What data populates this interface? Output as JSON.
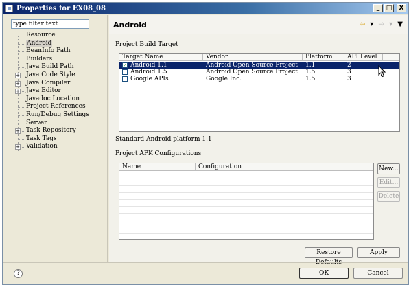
{
  "window": {
    "title": "Properties for EX08_08",
    "minimize": "_",
    "maximize": "□",
    "close": "X"
  },
  "sidebar": {
    "filter_value": "type filter text",
    "items": [
      {
        "label": "Resource",
        "expandable": false
      },
      {
        "label": "Android",
        "expandable": false,
        "selected": true
      },
      {
        "label": "BeanInfo Path",
        "expandable": false
      },
      {
        "label": "Builders",
        "expandable": false
      },
      {
        "label": "Java Build Path",
        "expandable": false
      },
      {
        "label": "Java Code Style",
        "expandable": true
      },
      {
        "label": "Java Compiler",
        "expandable": true
      },
      {
        "label": "Java Editor",
        "expandable": true
      },
      {
        "label": "Javadoc Location",
        "expandable": false
      },
      {
        "label": "Project References",
        "expandable": false
      },
      {
        "label": "Run/Debug Settings",
        "expandable": false
      },
      {
        "label": "Server",
        "expandable": false
      },
      {
        "label": "Task Repository",
        "expandable": true
      },
      {
        "label": "Task Tags",
        "expandable": false
      },
      {
        "label": "Validation",
        "expandable": true
      }
    ],
    "expand_glyph": "+"
  },
  "page": {
    "title": "Android",
    "nav_icons": {
      "back": "⇦",
      "back_menu": "▾",
      "forward": "⇨",
      "forward_menu": "▾",
      "view_menu": "▼"
    }
  },
  "build_target": {
    "section_label": "Project Build Target",
    "columns": [
      "Target Name",
      "Vendor",
      "Platform",
      "API Level"
    ],
    "rows": [
      {
        "checked": true,
        "name": "Android 1.1",
        "vendor": "Android Open Source Project",
        "platform": "1.1",
        "api": "2",
        "selected": true
      },
      {
        "checked": false,
        "name": "Android 1.5",
        "vendor": "Android Open Source Project",
        "platform": "1.5",
        "api": "3",
        "selected": false
      },
      {
        "checked": false,
        "name": "Google APIs",
        "vendor": "Google Inc.",
        "platform": "1.5",
        "api": "3",
        "selected": false
      }
    ],
    "description": "Standard Android platform 1.1"
  },
  "apk_config": {
    "section_label": "Project APK Configurations",
    "columns": [
      "Name",
      "Configuration"
    ],
    "buttons": {
      "new": "New...",
      "edit": "Edit...",
      "delete": "Delete"
    }
  },
  "footer_buttons": {
    "restore_defaults": "Restore Defaults",
    "apply": "Apply",
    "ok": "OK",
    "cancel": "Cancel",
    "help": "?"
  },
  "colors": {
    "selection": "#0a246a",
    "dialog_bg": "#ece9d8"
  }
}
